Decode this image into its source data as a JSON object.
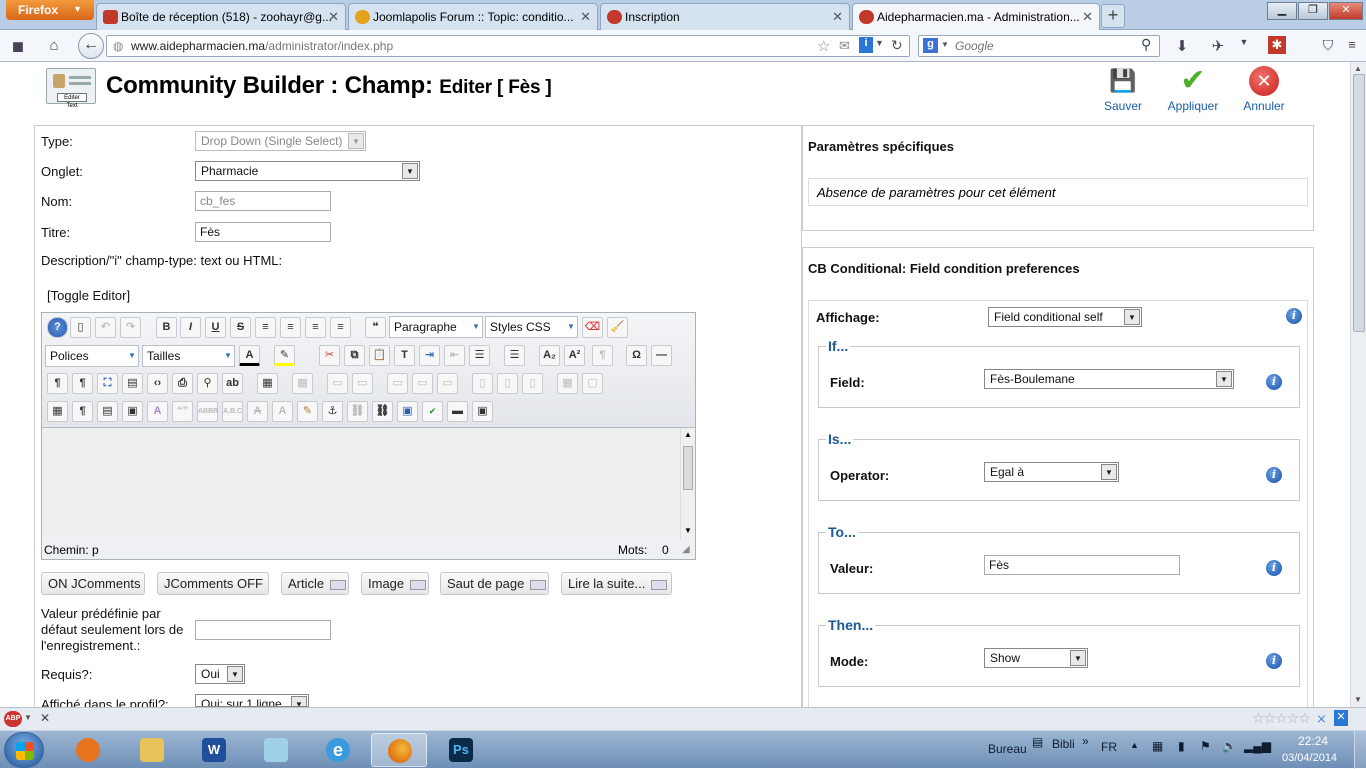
{
  "browser": {
    "app_button": "Firefox",
    "tabs": [
      {
        "title": "Boîte de réception (518) - zoohayr@g...",
        "icon_color": "#c0392b"
      },
      {
        "title": "Joomlapolis Forum :: Topic: conditio...",
        "icon_color": "#e6a21a"
      },
      {
        "title": "Inscription",
        "icon_color": "#c0392b"
      },
      {
        "title": "Aidepharmacien.ma - Administration...",
        "icon_color": "#c0392b"
      }
    ],
    "new_tab": "+",
    "url_domain": "www.aidepharmacien.ma",
    "url_path": "/administrator/index.php",
    "search_placeholder": "Google"
  },
  "page": {
    "title": "Community Builder : Champ:",
    "subtitle": "Editer [ Fès ]",
    "icon_label": "Editer Text",
    "toolbar": {
      "save": "Sauver",
      "apply": "Appliquer",
      "cancel": "Annuler"
    }
  },
  "form": {
    "type_label": "Type:",
    "type_value": "Drop Down (Single Select)",
    "tab_label": "Onglet:",
    "tab_value": "Pharmacie",
    "name_label": "Nom:",
    "name_value": "cb_fes",
    "title_label": "Titre:",
    "title_value": "Fès",
    "desc_label": "Description/\"i\" champ-type: text ou HTML:",
    "toggle_editor": "[Toggle Editor]",
    "default_label_1": "Valeur prédéfinie par",
    "default_label_2": "défaut seulement lors de",
    "default_label_3": "l'enregistrement.:",
    "default_value": "",
    "required_label": "Requis?:",
    "required_value": "Oui",
    "profile_label": "Affiché dans le profil?:",
    "profile_value": "Oui: sur 1 ligne"
  },
  "editor": {
    "format_value": "Paragraphe",
    "styles_value": "Styles CSS",
    "fonts_value": "Polices",
    "sizes_value": "Tailles",
    "path_label": "Chemin:",
    "path_value": "p",
    "words_label": "Mots:",
    "words_value": "0"
  },
  "plugin_buttons": [
    "ON JComments",
    "JComments OFF",
    "Article",
    "Image",
    "Saut de page",
    "Lire la suite..."
  ],
  "right": {
    "specific_title": "Paramètres spécifiques",
    "specific_empty": "Absence de paramètres pour cet élément",
    "cond_title": "CB Conditional: Field condition preferences",
    "display_label": "Affichage:",
    "display_value": "Field conditional self",
    "if_legend": "If...",
    "field_label": "Field:",
    "field_value": "Fès-Boulemane",
    "is_legend": "Is...",
    "operator_label": "Operator:",
    "operator_value": "Egal à",
    "to_legend": "To...",
    "value_label": "Valeur:",
    "value_value": "Fès",
    "then_legend": "Then...",
    "mode_label": "Mode:",
    "mode_value": "Show"
  },
  "taskbar": {
    "desktop_label": "Bureau",
    "bibli_label": "Bibli",
    "chevron": "»",
    "lang": "FR",
    "time": "22:24",
    "date": "03/04/2014"
  }
}
